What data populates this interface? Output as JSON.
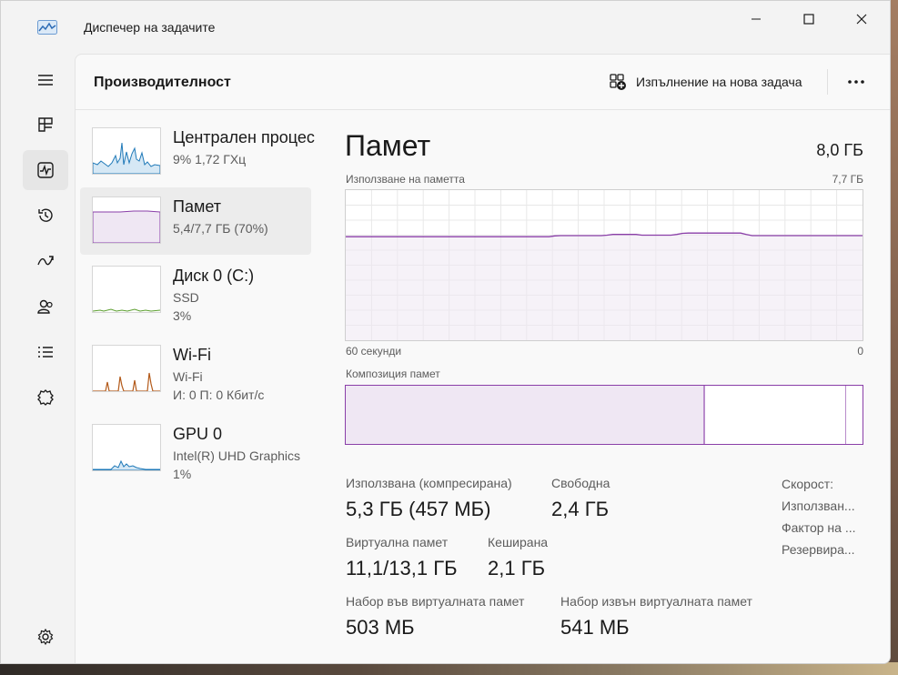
{
  "window": {
    "title": "Диспечер на задачите"
  },
  "header": {
    "title": "Производителност",
    "run_task_label": "Изпълнение на нова задача"
  },
  "nav": [
    {
      "name": "hamburger-menu",
      "icon": "hamburger-icon"
    },
    {
      "name": "processes",
      "icon": "processes-icon"
    },
    {
      "name": "performance",
      "icon": "performance-icon",
      "active": true
    },
    {
      "name": "app-history",
      "icon": "history-icon"
    },
    {
      "name": "startup-apps",
      "icon": "startup-icon"
    },
    {
      "name": "users",
      "icon": "users-icon"
    },
    {
      "name": "details",
      "icon": "details-icon"
    },
    {
      "name": "services",
      "icon": "services-icon"
    },
    {
      "name": "settings",
      "icon": "settings-icon"
    }
  ],
  "perf_items": [
    {
      "name": "Централен процесор",
      "sub1": "9%  1,72 ГХц",
      "sub2": ""
    },
    {
      "name": "Памет",
      "sub1": "5,4/7,7 ГБ (70%)",
      "sub2": "",
      "selected": true
    },
    {
      "name": "Диск 0 (C:)",
      "sub1": "SSD",
      "sub2": "3%"
    },
    {
      "name": "Wi-Fi",
      "sub1": "Wi-Fi",
      "sub2": "И: 0 П: 0 Кбит/с"
    },
    {
      "name": "GPU 0",
      "sub1": "Intel(R) UHD Graphics",
      "sub2": "1%"
    }
  ],
  "memory": {
    "title": "Памет",
    "total": "8,0 ГБ",
    "usage_label": "Използване на паметта",
    "usage_max": "7,7 ГБ",
    "time_left": "60 секунди",
    "time_right": "0",
    "composition_label": "Композиция памет",
    "composition": {
      "in_use_fraction": 0.695,
      "modified_fraction": 0.003,
      "standby_end_fraction": 0.97
    },
    "usage_series": [
      0.69,
      0.69,
      0.69,
      0.69,
      0.69,
      0.69,
      0.69,
      0.69,
      0.69,
      0.69,
      0.69,
      0.69,
      0.69,
      0.69,
      0.69,
      0.69,
      0.69,
      0.69,
      0.69,
      0.69,
      0.69,
      0.69,
      0.69,
      0.69,
      0.69,
      0.69,
      0.69,
      0.69,
      0.69,
      0.69,
      0.69,
      0.69,
      0.69,
      0.69,
      0.69,
      0.69,
      0.695,
      0.697,
      0.697,
      0.697,
      0.697,
      0.697,
      0.697,
      0.697,
      0.697,
      0.7,
      0.705,
      0.705,
      0.705,
      0.705,
      0.705,
      0.7,
      0.7,
      0.7,
      0.7,
      0.7,
      0.7,
      0.705,
      0.712,
      0.714,
      0.714,
      0.714,
      0.714,
      0.714,
      0.714,
      0.714,
      0.714,
      0.714,
      0.714,
      0.705,
      0.697,
      0.697,
      0.697,
      0.697,
      0.697,
      0.697,
      0.697,
      0.697,
      0.697,
      0.697,
      0.697,
      0.697,
      0.697,
      0.697,
      0.697,
      0.697,
      0.697,
      0.697,
      0.697,
      0.697
    ],
    "stats": {
      "in_use_label": "Използвана (компресирана)",
      "in_use_value": "5,3 ГБ (457 МБ)",
      "available_label": "Свободна",
      "available_value": "2,4 ГБ",
      "committed_label": "Виртуална памет",
      "committed_value": "11,1/13,1 ГБ",
      "cached_label": "Кеширана",
      "cached_value": "2,1 ГБ",
      "paged_label": "Набор във виртуалната памет",
      "paged_value": "503 МБ",
      "nonpaged_label": "Набор извън виртуалната памет",
      "nonpaged_value": "541 МБ"
    },
    "side_stats": [
      "Скорост:",
      "Използван...",
      "Фактор на ...",
      "Резервира..."
    ]
  },
  "colors": {
    "accent": "#2c6bb5",
    "memory": "#8a3fa8",
    "cpu": "#1f79b8",
    "disk": "#5b9e2e",
    "wifi": "#b35a1a"
  }
}
